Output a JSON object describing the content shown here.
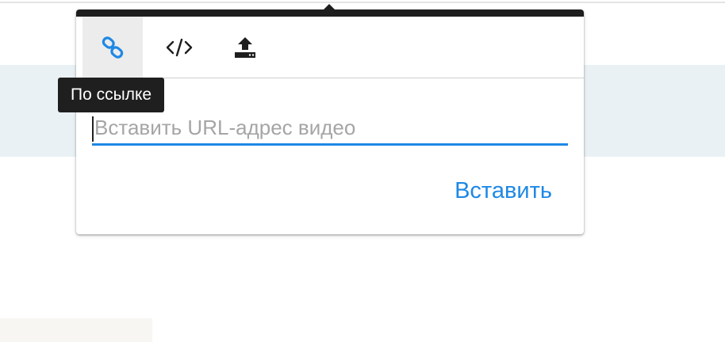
{
  "embed_popover": {
    "tabs": [
      {
        "id": "link",
        "icon": "link-icon",
        "active": true
      },
      {
        "id": "embed",
        "icon": "code-icon",
        "active": false
      },
      {
        "id": "upload",
        "icon": "upload-icon",
        "active": false
      }
    ],
    "tooltip": "По ссылке",
    "url_input": {
      "placeholder": "Вставить URL-адрес видео",
      "value": ""
    },
    "insert_label": "Вставить"
  },
  "colors": {
    "accent": "#1e88e5",
    "popover_header": "#1e1e1e",
    "active_tab": "#ececec",
    "band": "#eaf1f5",
    "tooltip_bg": "#1f1f1f"
  }
}
